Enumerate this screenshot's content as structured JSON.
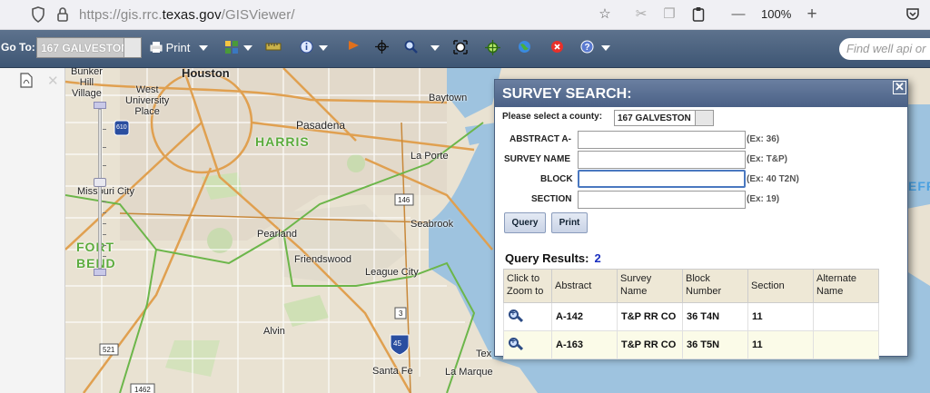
{
  "browser": {
    "url_prefix": "https://gis.rrc.",
    "url_domain": "texas.gov",
    "url_path": "/GISViewer/",
    "zoom_level": "100%"
  },
  "toolbar": {
    "goto_label": "Go To:",
    "goto_value": "167 GALVESTON",
    "print_label": "Print",
    "find_placeholder": "Find well api or"
  },
  "map": {
    "labels": {
      "houston": "Houston",
      "bunker_hill": "Bunker\nHill\nVillage",
      "west_university": "West\nUniversity\nPlace",
      "baytown": "Baytown",
      "pasadena": "Pasadena",
      "harris": "HARRIS",
      "la_porte": "La Porte",
      "missouri_city": "Missouri City",
      "seabrook": "Seabrook",
      "fort_bend": "FORT\nBEND",
      "pearland": "Pearland",
      "friendswood": "Friendswood",
      "league_city": "League City",
      "alvin": "Alvin",
      "santa_fe": "Santa Fe",
      "la_marque": "La Marque",
      "tex": "Tex",
      "jeff": "EFF",
      "hwy_610": "610",
      "hwy_146": "146",
      "hwy_3": "3",
      "hwy_45": "45",
      "hwy_521": "521",
      "hwy_1462": "1462"
    }
  },
  "dialog": {
    "title": "SURVEY SEARCH:",
    "county_prompt": "Please select a county:",
    "county_value": "167 GALVESTON",
    "fields": [
      {
        "label": "ABSTRACT A-",
        "value": "",
        "hint": "(Ex: 36)"
      },
      {
        "label": "SURVEY NAME",
        "value": "",
        "hint": "(Ex: T&P)"
      },
      {
        "label": "BLOCK",
        "value": "",
        "hint": "(Ex: 40 T2N)"
      },
      {
        "label": "SECTION",
        "value": "",
        "hint": "(Ex: 19)"
      }
    ],
    "query_button": "Query",
    "print_button": "Print",
    "results_label": "Query Results:",
    "results_count": "2",
    "columns": {
      "zoom_line1": "Click to",
      "zoom_line2": "Zoom to",
      "abstract": "Abstract",
      "survey_line1": "Survey",
      "survey_line2": "Name",
      "block_line1": "Block",
      "block_line2": "Number",
      "section": "Section",
      "alt_line1": "Alternate",
      "alt_line2": "Name"
    },
    "rows": [
      {
        "abstract": "A-142",
        "survey_name": "T&P RR CO",
        "block": "36 T4N",
        "section": "11",
        "alternate": ""
      },
      {
        "abstract": "A-163",
        "survey_name": "T&P RR CO",
        "block": "36 T5N",
        "section": "11",
        "alternate": ""
      }
    ]
  }
}
